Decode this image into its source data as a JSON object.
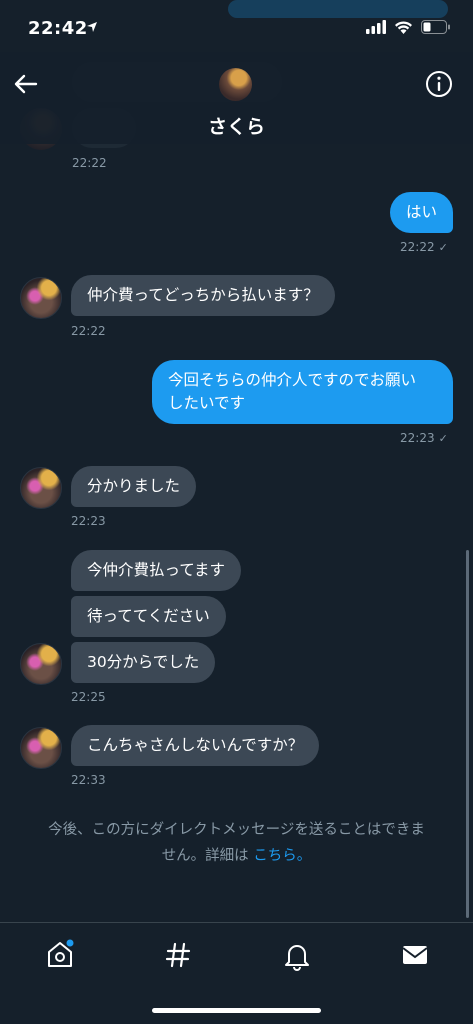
{
  "status_bar": {
    "time": "22:42"
  },
  "header": {
    "name": "さくら"
  },
  "messages": [
    {
      "text": "はい",
      "time": "22:22"
    },
    {
      "text": "仲介費ってどっちから払います？",
      "time": "22:22"
    },
    {
      "text": "今回そちらの仲介人ですのでお願い",
      "text2": "したいです",
      "time": "22:23"
    },
    {
      "text": "分かりました",
      "time": "22:23"
    },
    {
      "text": "今仲介費払ってます"
    },
    {
      "text": "待っててください"
    },
    {
      "text": "30分からでした",
      "time": "22:25"
    },
    {
      "text": "こんちゃさんしないんですか？",
      "time": "22:33"
    }
  ],
  "top_time": "22:22",
  "notice": {
    "line1": "今後、この方にダイレクトメッセージを送ることはできま",
    "line2": "せん。詳細は",
    "link": "こちら。"
  },
  "colors": {
    "background": "#15202b",
    "incoming_bubble": "#3c4855",
    "outgoing_bubble": "#1d9bf0",
    "muted_text": "#8899a6"
  },
  "icons": [
    "location-arrow-icon",
    "signal-icon",
    "wifi-icon",
    "battery-icon",
    "back-arrow-icon",
    "info-icon",
    "home-icon",
    "hashtag-icon",
    "bell-icon",
    "mail-icon"
  ]
}
